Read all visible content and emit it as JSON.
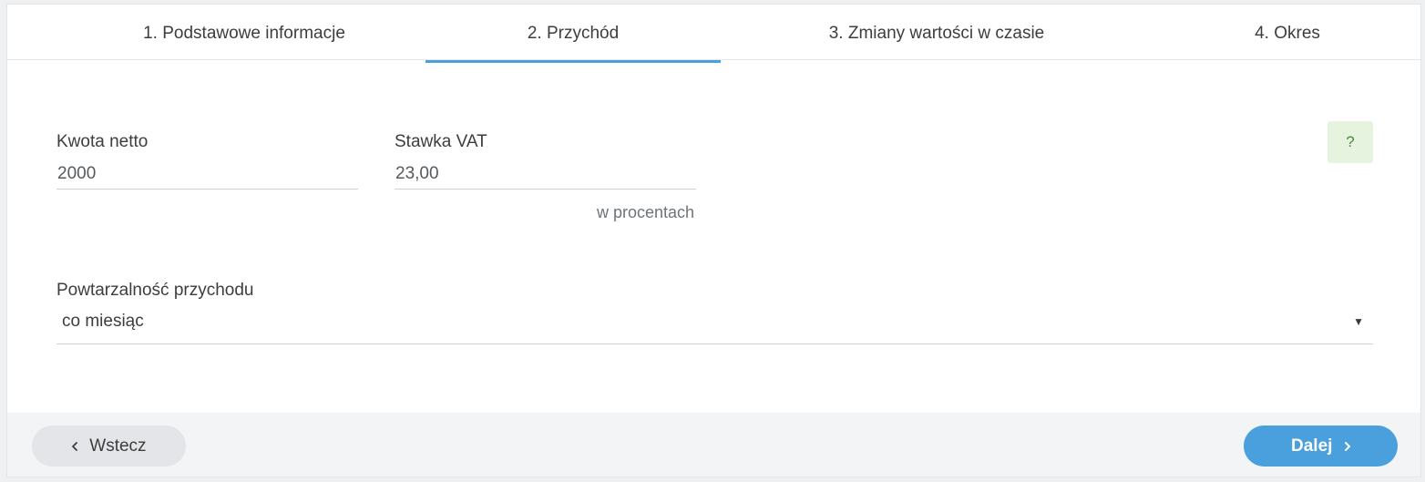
{
  "tabs": [
    {
      "label": "1. Podstawowe informacje",
      "active": false
    },
    {
      "label": "2. Przychód",
      "active": true
    },
    {
      "label": "3. Zmiany wartości w czasie",
      "active": false
    },
    {
      "label": "4. Okres",
      "active": false
    }
  ],
  "form": {
    "net_amount": {
      "label": "Kwota netto",
      "value": "2000"
    },
    "vat_rate": {
      "label": "Stawka VAT",
      "value": "23,00",
      "hint": "w procentach"
    },
    "help_label": "?",
    "recurrence": {
      "label": "Powtarzalność przychodu",
      "value": "co miesiąc"
    }
  },
  "footer": {
    "back_label": "Wstecz",
    "next_label": "Dalej"
  },
  "colors": {
    "accent": "#4a9fdd",
    "help_bg": "#e6f3df",
    "help_fg": "#4d8a35"
  },
  "icons": {
    "back": "chevron-left-icon",
    "next": "chevron-right-icon",
    "dropdown": "caret-down-icon"
  }
}
